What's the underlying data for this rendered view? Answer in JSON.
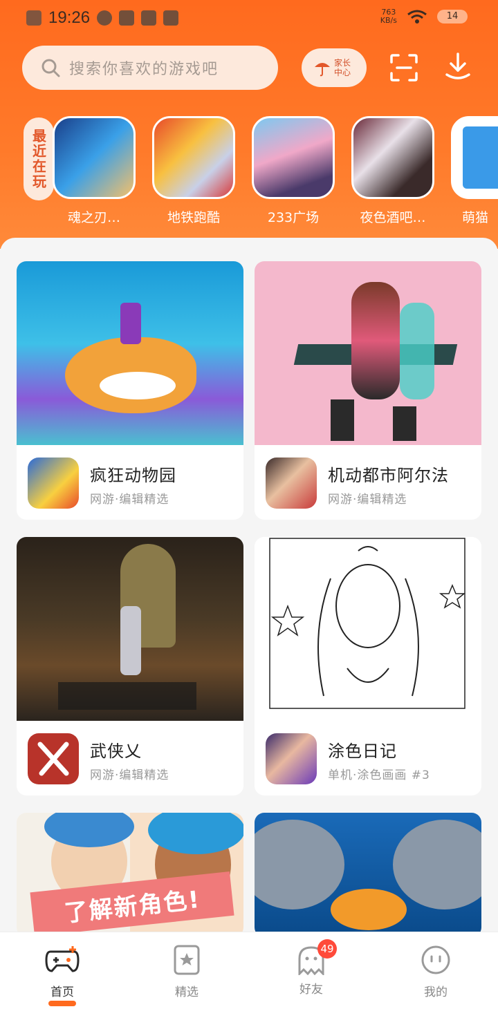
{
  "status_bar": {
    "time": "19:26",
    "net_speed_value": "763",
    "net_speed_unit": "KB/s",
    "battery": "14"
  },
  "header": {
    "search_placeholder": "搜索你喜欢的游戏吧",
    "parent_center_label": "家长中心",
    "colors": {
      "accent": "#ff6a1e",
      "search_bg": "#fde9dc"
    }
  },
  "recent": {
    "tag": "最近在玩",
    "games": [
      {
        "name": "魂之刃…"
      },
      {
        "name": "地铁跑酷"
      },
      {
        "name": "233广场"
      },
      {
        "name": "夜色酒吧…"
      },
      {
        "name": "萌猫"
      }
    ]
  },
  "feed": {
    "cards": [
      {
        "title": "疯狂动物园",
        "subtitle": "网游·编辑精选"
      },
      {
        "title": "机动都市阿尔法",
        "subtitle": "网游·编辑精选"
      },
      {
        "title": "武侠乂",
        "subtitle": "网游·编辑精选"
      },
      {
        "title": "涂色日记",
        "subtitle": "单机·涂色画画 #3"
      },
      {
        "title": "",
        "subtitle": "",
        "banner_text": "了解新角色!"
      },
      {
        "title": "",
        "subtitle": ""
      }
    ]
  },
  "bottom_nav": {
    "items": [
      {
        "label": "首页",
        "active": true
      },
      {
        "label": "精选",
        "active": false
      },
      {
        "label": "好友",
        "active": false,
        "badge": "49"
      },
      {
        "label": "我的",
        "active": false
      }
    ]
  }
}
